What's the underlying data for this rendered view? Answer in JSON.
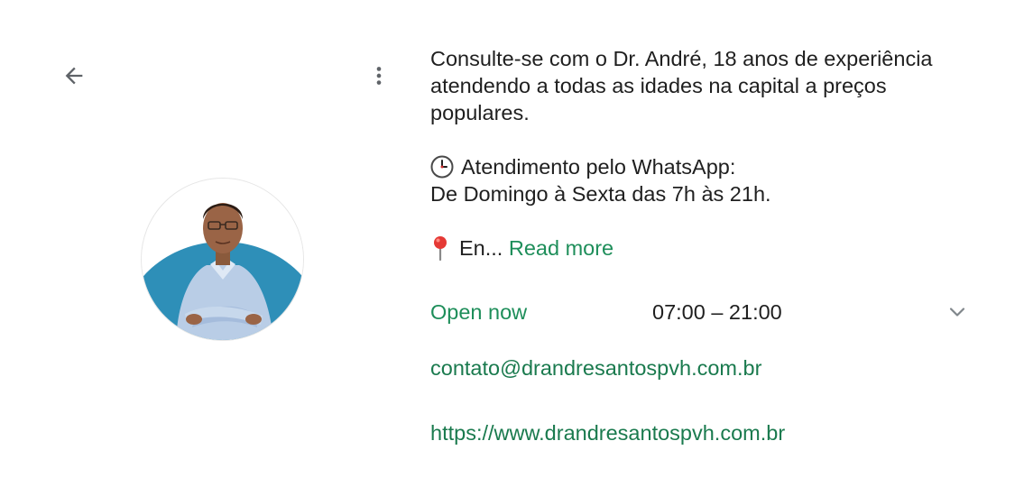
{
  "toolbar": {
    "back_icon": "arrow-back-icon",
    "more_icon": "more-vert-icon"
  },
  "profile": {
    "avatar_icon": "doctor-portrait"
  },
  "about": {
    "line1": "Consulte-se com o Dr. André, 18 anos de experiência",
    "line2": "atendendo a todas as idades na capital a preços",
    "line3": "populares.",
    "whatsapp_line1": "Atendimento pelo WhatsApp:",
    "whatsapp_line2": "De Domingo à Sexta das 7h às 21h.",
    "truncated_text": "En...",
    "read_more_label": "Read more",
    "clock_icon": "clock-icon",
    "pin_icon": "pin-icon"
  },
  "hours": {
    "status": "Open now",
    "time_range": "07:00 – 21:00",
    "expand_icon": "chevron-down-icon"
  },
  "contact": {
    "email": "contato@drandresantospvh.com.br",
    "website": "https://www.drandresantospvh.com.br"
  },
  "colors": {
    "accent_green": "#1e8e5a",
    "text": "#1f1f1f",
    "icon_gray": "#5f6368",
    "avatar_bg_blue": "#2e8fb8"
  }
}
